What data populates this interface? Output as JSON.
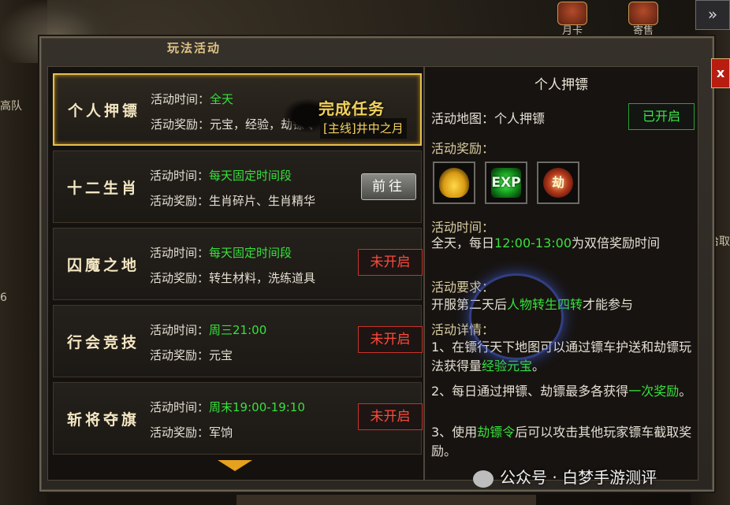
{
  "window": {
    "title": "玩法活动",
    "close_label": "x"
  },
  "hud": {
    "top_icons": [
      {
        "label": "月卡"
      },
      {
        "label": "寄售"
      }
    ],
    "expand_label": "»",
    "left_labels": [
      "高队",
      "6"
    ],
    "right_label": "拾取"
  },
  "activities": [
    {
      "name": "个人押镖",
      "time_label": "活动时间：",
      "time_value": "全天",
      "reward_label": "活动奖励：",
      "reward_value": "元宝，经验，劫镖令",
      "status": "selected"
    },
    {
      "name": "十二生肖",
      "time_label": "活动时间：",
      "time_value": "每天固定时间段",
      "reward_label": "活动奖励：",
      "reward_value": "生肖碎片、生肖精华",
      "button_label": "前往"
    },
    {
      "name": "囚魔之地",
      "time_label": "活动时间：",
      "time_value": "每天固定时间段",
      "reward_label": "活动奖励：",
      "reward_value": "转生材料，洗练道具",
      "button_label": "未开启"
    },
    {
      "name": "行会竞技",
      "time_label": "活动时间：",
      "time_value": "周三21:00",
      "reward_label": "活动奖励：",
      "reward_value": "元宝",
      "button_label": "未开启"
    },
    {
      "name": "斩将夺旗",
      "time_label": "活动时间：",
      "time_value": "周末19:00-19:10",
      "reward_label": "活动奖励：",
      "reward_value": "军饷",
      "button_label": "未开启"
    }
  ],
  "quest_overlay": {
    "big_text": "完成任务",
    "tag_text": "[主线]井中之月"
  },
  "detail": {
    "title": "个人押镖",
    "map_label": "活动地图：个人押镖",
    "status_button": "已开启",
    "rewards_label": "活动奖励：",
    "reward_icons": [
      {
        "icon": "gold-ingot-icon",
        "text": ""
      },
      {
        "icon": "exp-icon",
        "text": "EXP"
      },
      {
        "icon": "escort-token-icon",
        "text": "劫"
      }
    ],
    "time_label": "活动时间：",
    "time_text_1": "全天，每日",
    "time_highlight": "12:00-13:00",
    "time_text_2": "为双倍奖励时间",
    "requirement_label": "活动要求：",
    "requirement_text_1": "开服第二天后",
    "requirement_highlight": "人物转生四转",
    "requirement_text_2": "才能参与",
    "details_label": "活动详情：",
    "detail_1_a": "1、在镖行天下地图可以通过镖车护送和劫镖玩法获得量",
    "detail_1_b": "经验元宝",
    "detail_1_c": "。",
    "detail_2_a": "2、每日通过押镖、劫镖最多各获得",
    "detail_2_b": "一次奖励",
    "detail_2_c": "。",
    "detail_3_a": "3、使用",
    "detail_3_b": "劫镖令",
    "detail_3_c": "后可以攻击其他玩家镖车截取奖励。"
  },
  "watermark": "公众号 · 白梦手游测评",
  "colors": {
    "highlight_green": "#37e13c",
    "gold_border": "#e5bf4f",
    "closed_red": "#ff4a3b"
  }
}
